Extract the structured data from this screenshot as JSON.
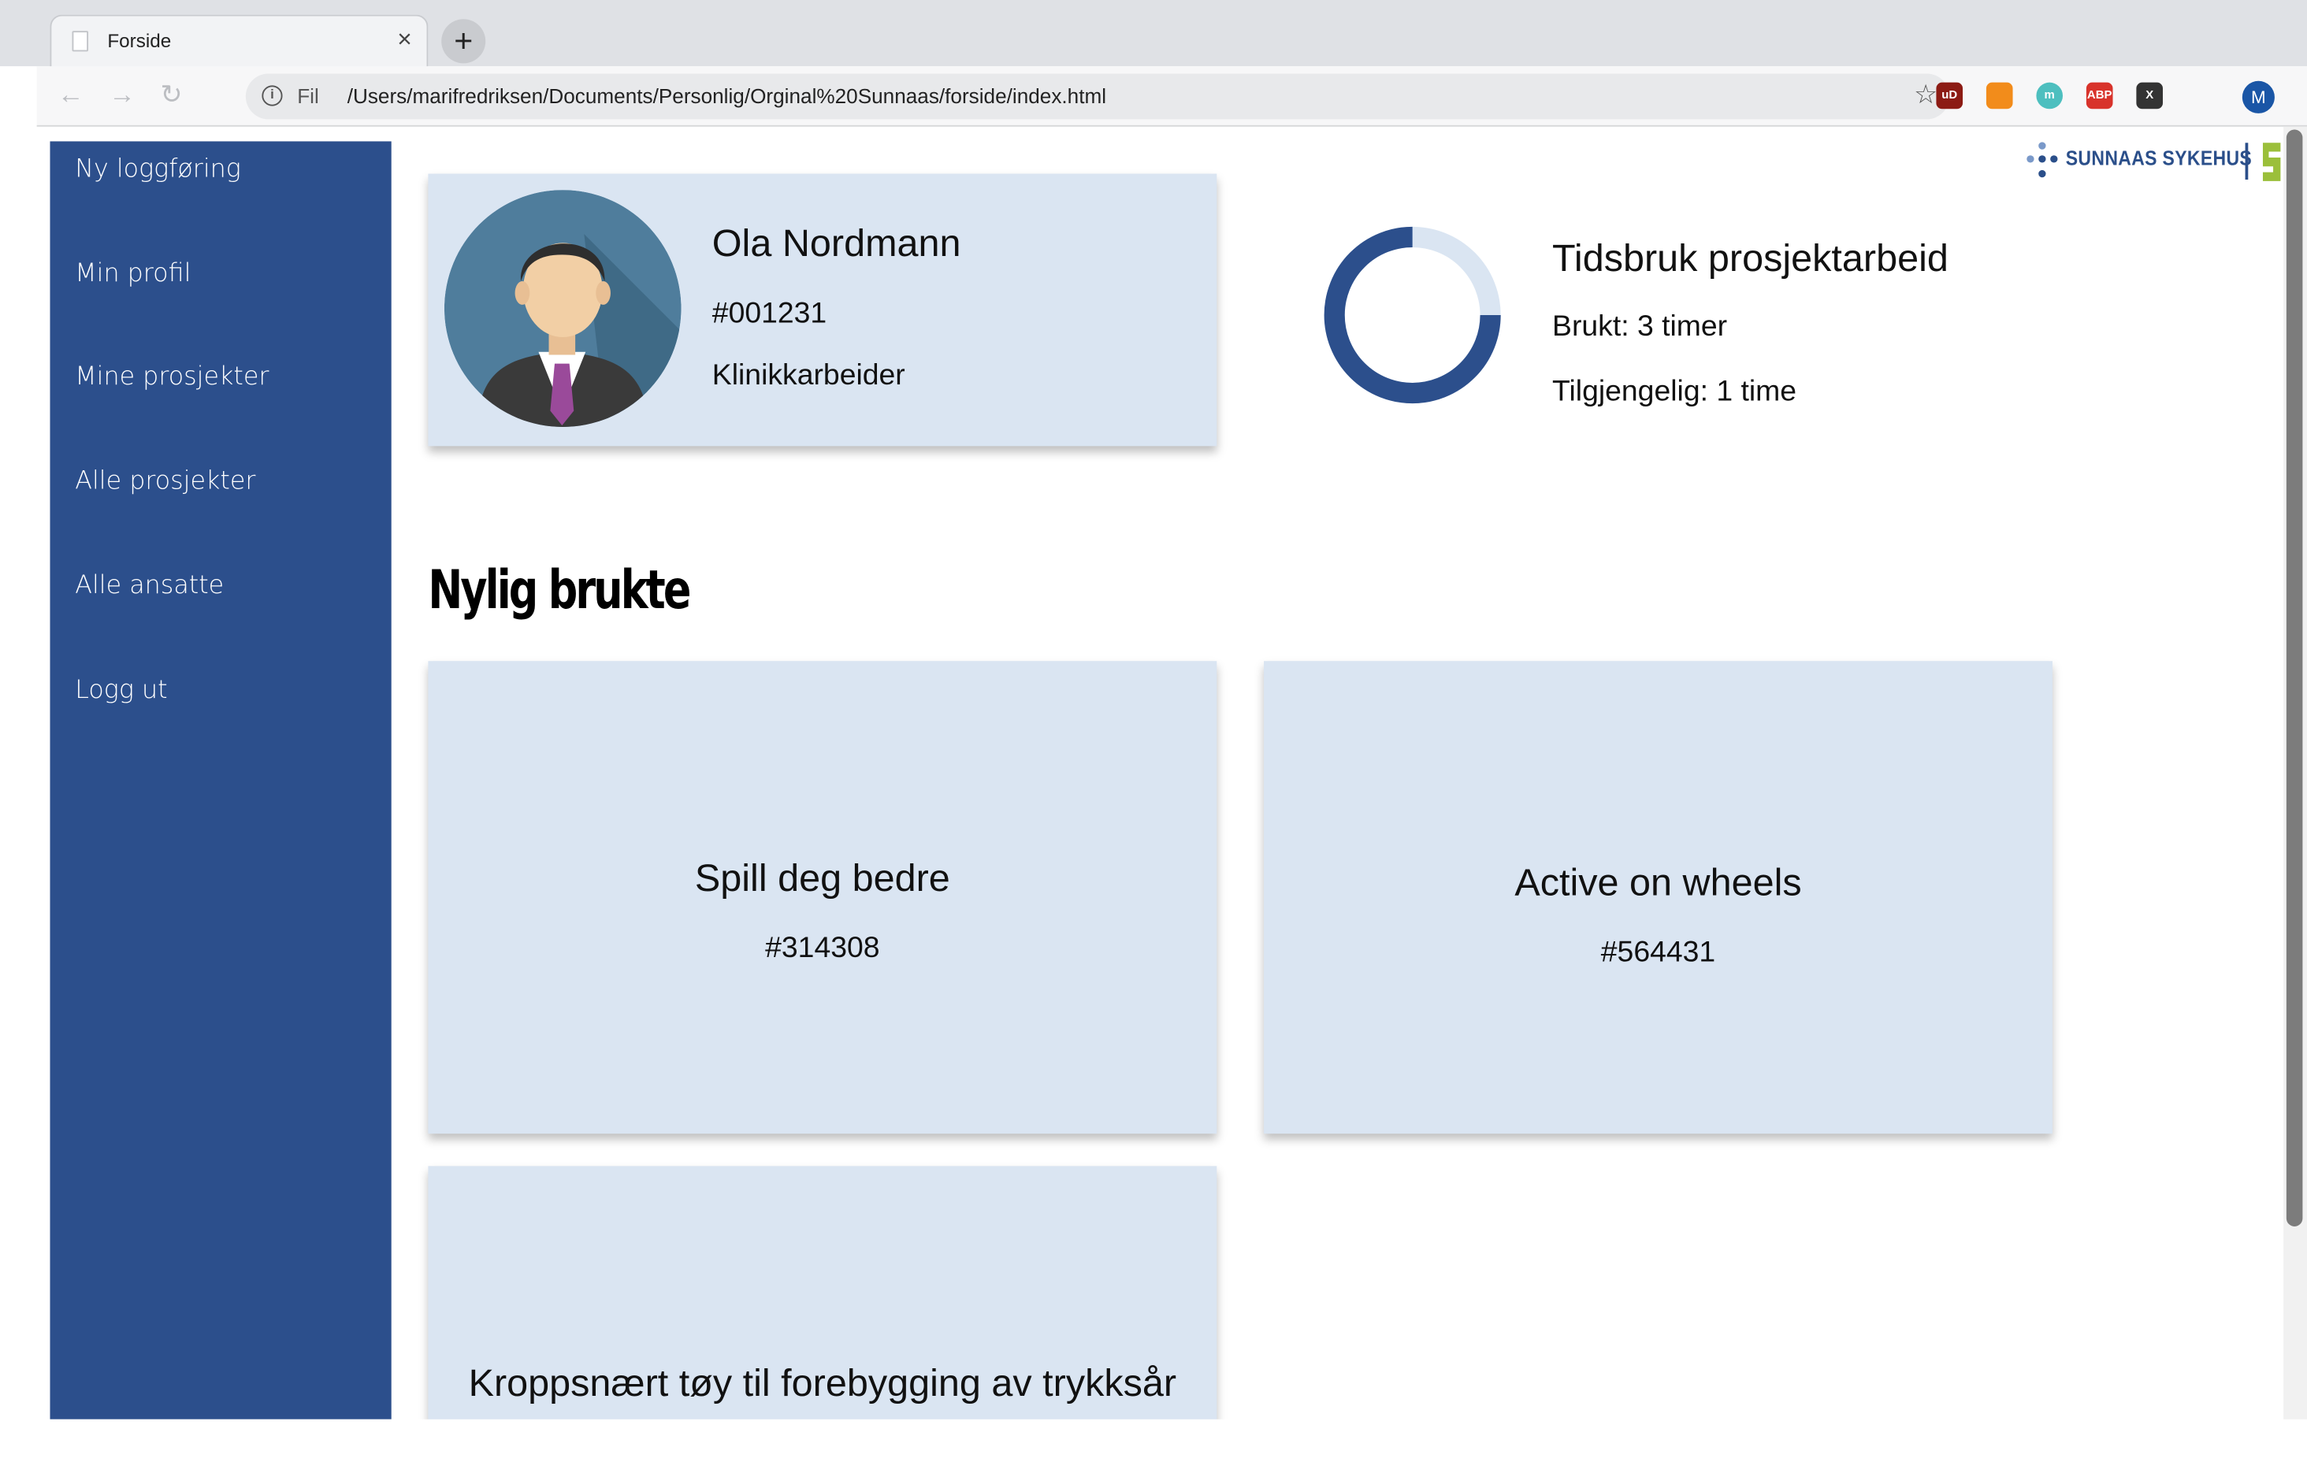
{
  "browser": {
    "tab_title": "Forside",
    "tab_close": "×",
    "new_tab": "+",
    "scheme": "Fil",
    "url": "/Users/marifredriksen/Documents/Personlig/Orginal%20Sunnaas/forside/index.html",
    "profile_initial": "M",
    "extensions": [
      {
        "name": "ublock-icon",
        "label": "uD",
        "color": "#8c1b14"
      },
      {
        "name": "flame-icon",
        "label": "",
        "color": "#f28c1b"
      },
      {
        "name": "mercury-icon",
        "label": "m",
        "color": "#4dbfbf"
      },
      {
        "name": "adblock-plus-icon",
        "label": "ABP",
        "color": "#d8332b"
      },
      {
        "name": "x-extension-icon",
        "label": "X",
        "color": "#333333"
      }
    ]
  },
  "sidebar": {
    "items": [
      {
        "label": "Ny loggføring"
      },
      {
        "label": "Min profil"
      },
      {
        "label": "Mine prosjekter"
      },
      {
        "label": "Alle prosjekter"
      },
      {
        "label": "Alle ansatte"
      },
      {
        "label": "Logg ut"
      }
    ]
  },
  "logo": {
    "text": "SUNNAAS SYKEHUS"
  },
  "profile": {
    "name": "Ola Nordmann",
    "id": "#001231",
    "role": "Klinikkarbeider"
  },
  "time_usage": {
    "title": "Tidsbruk prosjektarbeid",
    "used": "Brukt: 3 timer",
    "available": "Tilgjengelig: 1 time",
    "used_fraction": 0.75
  },
  "recent": {
    "heading": "Nylig brukte",
    "projects": [
      {
        "name": "Spill deg bedre",
        "id": "#314308"
      },
      {
        "name": "Active on wheels",
        "id": "#564431"
      },
      {
        "name": "Kroppsnært tøy til forebygging av trykksår",
        "id": ""
      }
    ]
  },
  "colors": {
    "sidebar": "#2c4f8c",
    "card": "#dae5f2",
    "donut_used": "#2c4f8c",
    "donut_remaining": "#dae5f2"
  }
}
